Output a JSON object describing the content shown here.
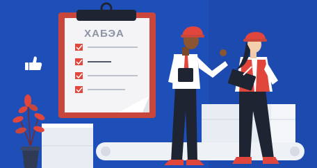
{
  "clipboard": {
    "title": "ХАБЭА",
    "checklist_items": 4
  },
  "colors": {
    "background": "#1e4fb8",
    "clipboard_board": "#c9463c",
    "paper": "#f4f4f6",
    "check_box": "#e0463c",
    "helmet": "#e0463c",
    "vest": "#e0463c",
    "trousers": "#1f2433",
    "plant": "#e0463c",
    "like_icon": "#ffffff"
  },
  "icons": {
    "like": "thumbs-up-icon",
    "ok_gesture": "ok-hand-icon",
    "pen": "pen-icon"
  }
}
